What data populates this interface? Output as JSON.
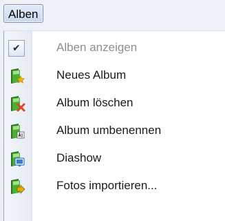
{
  "menubar": {
    "menu_label": "Alben"
  },
  "menu": {
    "items": [
      {
        "label": "Alben anzeigen",
        "icon": "checkmark-icon",
        "checked": true,
        "enabled": false
      },
      {
        "label": "Neues Album",
        "icon": "new-album-icon",
        "enabled": true
      },
      {
        "label": "Album löschen",
        "icon": "delete-album-icon",
        "enabled": true
      },
      {
        "label": "Album umbenennen",
        "icon": "rename-album-icon",
        "enabled": true
      },
      {
        "label": "Diashow",
        "icon": "slideshow-icon",
        "enabled": true
      },
      {
        "label": "Fotos importieren...",
        "icon": "import-photos-icon",
        "enabled": true
      }
    ]
  },
  "colors": {
    "album_green": "#3f9a2e",
    "album_dark": "#2f6f22",
    "new_star": "#f0b400",
    "delete_x": "#d94a1e",
    "slideshow_blue": "#3a7fd0",
    "import_arrow": "#e8a900"
  }
}
